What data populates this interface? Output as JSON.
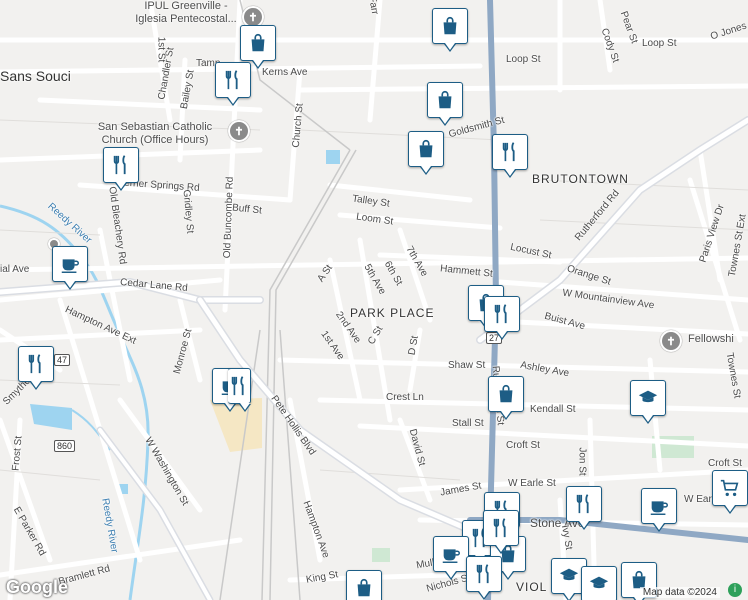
{
  "map": {
    "attribution": "Map data ©2024",
    "logo": "Google",
    "area_labels": [
      {
        "text": "Sans Souci"
      },
      {
        "text": "BRUTONTOWN"
      },
      {
        "text": "PARK PLACE"
      },
      {
        "text": "VIOL"
      }
    ],
    "poi_labels": [
      {
        "text": "IPUL Greenville - Iglesia Pentecostal..."
      },
      {
        "text": "San Sebastian Catholic Church (Office Hours)"
      },
      {
        "text": "Fellowshi"
      }
    ],
    "water_labels": [
      {
        "text": "Reedy River"
      },
      {
        "text": "Reedy River"
      }
    ],
    "street_labels": [
      {
        "text": "Loop St"
      },
      {
        "text": "Loop St"
      },
      {
        "text": "O Jones"
      },
      {
        "text": "Pear St"
      },
      {
        "text": "Cody St"
      },
      {
        "text": "Kerns Ave"
      },
      {
        "text": "Tamp"
      },
      {
        "text": "Church St"
      },
      {
        "text": "Chandler St"
      },
      {
        "text": "Bailey St"
      },
      {
        "text": "1st St"
      },
      {
        "text": "Goldsmith St"
      },
      {
        "text": "Talley St"
      },
      {
        "text": "Loom St"
      },
      {
        "text": "Verner Springs Rd"
      },
      {
        "text": "Buff St"
      },
      {
        "text": "Old Bleachery Rd"
      },
      {
        "text": "Gridley St"
      },
      {
        "text": "Old Buncombe Rd"
      },
      {
        "text": "Rutherford Rd"
      },
      {
        "text": "Paris View Dr"
      },
      {
        "text": "Townes St Ext"
      },
      {
        "text": "Locust St"
      },
      {
        "text": "Hammett St"
      },
      {
        "text": "7th Ave"
      },
      {
        "text": "6th St"
      },
      {
        "text": "5th Ave"
      },
      {
        "text": "A St"
      },
      {
        "text": "Orange St"
      },
      {
        "text": "W Mountainview Ave"
      },
      {
        "text": "Buist Ave"
      },
      {
        "text": "Cedar Lane Rd"
      },
      {
        "text": "Hampton Ave Ext"
      },
      {
        "text": "Monroe St"
      },
      {
        "text": "2nd Ave"
      },
      {
        "text": "1st Ave"
      },
      {
        "text": "C St"
      },
      {
        "text": "D St"
      },
      {
        "text": "Shaw St"
      },
      {
        "text": "Ashley Ave"
      },
      {
        "text": "Rutherford St"
      },
      {
        "text": "Crest Ln"
      },
      {
        "text": "Kendall St"
      },
      {
        "text": "Stall St"
      },
      {
        "text": "Croft St"
      },
      {
        "text": "Croft St"
      },
      {
        "text": "David St"
      },
      {
        "text": "Pete Hollis Blvd"
      },
      {
        "text": "W Washington St"
      },
      {
        "text": "Frost St"
      },
      {
        "text": "E Parker Rd"
      },
      {
        "text": "Bramlett Rd"
      },
      {
        "text": "Hampton Ave"
      },
      {
        "text": "James St"
      },
      {
        "text": "W Earle St"
      },
      {
        "text": "W Earle"
      },
      {
        "text": "Stone Ave"
      },
      {
        "text": "Mulberry St"
      },
      {
        "text": "King St"
      },
      {
        "text": "Nichols St"
      },
      {
        "text": "Townes St"
      },
      {
        "text": "Ivy St"
      },
      {
        "text": "Jon St"
      },
      {
        "text": "Smythe"
      },
      {
        "text": "ial Ave"
      },
      {
        "text": "Farr"
      }
    ],
    "shields": [
      {
        "text": "27"
      },
      {
        "text": "47"
      },
      {
        "text": "860"
      }
    ],
    "markers": [
      {
        "type": "shopping",
        "icon": "shopping-bag-icon"
      },
      {
        "type": "shopping",
        "icon": "shopping-bag-icon"
      },
      {
        "type": "shopping",
        "icon": "shopping-bag-icon"
      },
      {
        "type": "shopping",
        "icon": "shopping-bag-icon"
      },
      {
        "type": "restaurant",
        "icon": "fork-knife-icon"
      },
      {
        "type": "restaurant",
        "icon": "fork-knife-icon"
      },
      {
        "type": "restaurant",
        "icon": "fork-knife-icon"
      },
      {
        "type": "cafe",
        "icon": "coffee-cup-icon"
      },
      {
        "type": "cafe",
        "icon": "coffee-cup-icon"
      },
      {
        "type": "restaurant",
        "icon": "fork-knife-icon"
      },
      {
        "type": "shopping",
        "icon": "shopping-bag-icon"
      },
      {
        "type": "restaurant",
        "icon": "fork-knife-icon"
      },
      {
        "type": "shopping",
        "icon": "shopping-bag-icon"
      },
      {
        "type": "school",
        "icon": "graduation-cap-icon"
      },
      {
        "type": "cafe",
        "icon": "coffee-cup-icon"
      },
      {
        "type": "grocery",
        "icon": "shopping-cart-icon"
      },
      {
        "type": "restaurant",
        "icon": "fork-knife-icon"
      },
      {
        "type": "restaurant",
        "icon": "fork-knife-icon"
      },
      {
        "type": "restaurant",
        "icon": "fork-knife-icon"
      },
      {
        "type": "cafe",
        "icon": "coffee-cup-icon"
      },
      {
        "type": "shopping",
        "icon": "shopping-bag-icon"
      },
      {
        "type": "restaurant",
        "icon": "fork-knife-icon"
      },
      {
        "type": "school",
        "icon": "graduation-cap-icon"
      },
      {
        "type": "school",
        "icon": "graduation-cap-icon"
      },
      {
        "type": "shopping",
        "icon": "shopping-bag-icon"
      },
      {
        "type": "shopping",
        "icon": "shopping-bag-icon"
      },
      {
        "type": "restaurant",
        "icon": "fork-knife-icon"
      },
      {
        "type": "restaurant",
        "icon": "fork-knife-icon"
      }
    ],
    "colors": {
      "background": "#f2f1ef",
      "street": "#ffffff",
      "highway": "#8fa8c4",
      "water": "#9ed4f0",
      "pin_border": "#1d5d85",
      "pin_icon": "#1d5d85"
    }
  }
}
